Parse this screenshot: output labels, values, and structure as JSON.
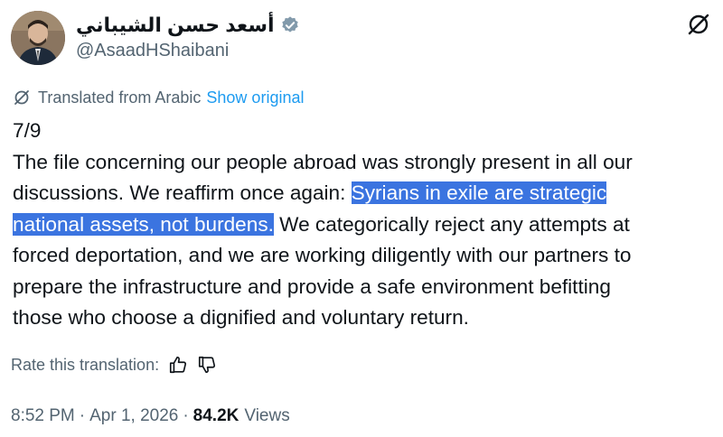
{
  "author": {
    "display_name": "أسعد حسن الشيباني",
    "handle": "@AsaadHShaibani",
    "verified": true
  },
  "icons": {
    "top_right": "grok-translate-icon",
    "translate": "translate-icon",
    "like": "thumbs-up-icon",
    "dislike": "thumbs-down-icon"
  },
  "translation": {
    "label": "Translated from Arabic",
    "show_original": "Show original"
  },
  "tweet": {
    "counter": "7/9",
    "line1": "The file concerning our people abroad was strongly present in all our",
    "line2_pre": "discussions. We reaffirm once again: ",
    "line2_hl": "Syrians in exile are strategic",
    "line3_hl": "national assets, not burdens.",
    "line3_post": " We categorically reject any attempts at",
    "line4": "forced deportation, and we are working diligently with our partners to",
    "line5": "prepare the infrastructure and provide a safe environment befitting",
    "line6": "those who choose a dignified and voluntary return."
  },
  "rate": {
    "label": "Rate this translation:"
  },
  "meta": {
    "time": "8:52 PM",
    "separator": "·",
    "date": "Apr 1, 2026",
    "views_count": "84.2K",
    "views_label": "Views"
  },
  "colors": {
    "text": "#0f1419",
    "secondary": "#536471",
    "link": "#1d9bf0",
    "highlight": "#3b74e0"
  }
}
